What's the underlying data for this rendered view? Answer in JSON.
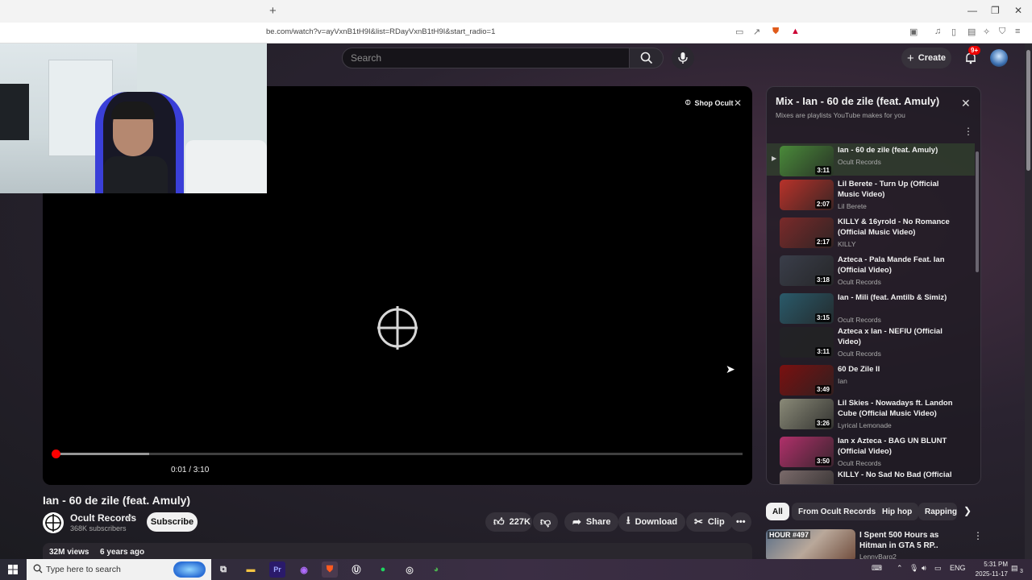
{
  "browser": {
    "new_tab": "+",
    "url": "be.com/watch?v=ayVxnB1tH9I&list=RDayVxnB1tH9I&start_radio=1",
    "window_controls": [
      "—",
      "❐",
      "✕"
    ]
  },
  "masthead": {
    "search_placeholder": "Search",
    "create_label": "Create",
    "notifications_badge": "9+"
  },
  "player": {
    "shop_label": "Shop Ocult",
    "time": "0:01 / 3:10",
    "progress_fraction": 0.005,
    "buffer_fraction": 0.14
  },
  "video": {
    "title": "Ian - 60 de zile (feat. Amuly)",
    "channel": "Ocult Records",
    "subscribers": "368K subscribers",
    "subscribe_label": "Subscribe",
    "likes": "227K",
    "share_label": "Share",
    "download_label": "Download",
    "clip_label": "Clip",
    "views": "32M views",
    "age": "6 years ago"
  },
  "playlist": {
    "title": "Mix - Ian - 60 de zile (feat. Amuly)",
    "subtitle": "Mixes are playlists YouTube makes for you",
    "items": [
      {
        "title": "Ian - 60 de zile (feat. Amuly)",
        "channel": "Ocult Records",
        "duration": "3:11",
        "color": "#4a8a3a"
      },
      {
        "title": "Lil Berete - Turn Up (Official Music Video)",
        "channel": "Lil Berete",
        "duration": "2:07",
        "color": "#b8322a"
      },
      {
        "title": "KILLY & 16yrold - No Romance (Official Music Video)",
        "channel": "KILLY",
        "duration": "2:17",
        "color": "#7a2a2a"
      },
      {
        "title": "Azteca - Pala Mande Feat. Ian (Official Video)",
        "channel": "Ocult Records",
        "duration": "3:18",
        "color": "#3a3e4a"
      },
      {
        "title": "Ian - Mili (feat. Amtilb & Simiz)",
        "channel": "Ocult Records",
        "duration": "3:15",
        "color": "#2a5a6a"
      },
      {
        "title": "Azteca x Ian - NEFIU (Official Video)",
        "channel": "Ocult Records",
        "duration": "3:11",
        "color": "#222226"
      },
      {
        "title": "60 De Zile II",
        "channel": "Ian",
        "duration": "3:49",
        "color": "#7a1010"
      },
      {
        "title": "Lil Skies - Nowadays ft. Landon Cube (Official Music Video)",
        "channel": "Lyrical Lemonade",
        "duration": "3:26",
        "color": "#8a8a78"
      },
      {
        "title": "Ian x Azteca - BAG UN BLUNT (Official Video)",
        "channel": "Ocult Records",
        "duration": "3:50",
        "color": "#b0306a"
      },
      {
        "title": "KILLY - No Sad No Bad (Official",
        "channel": "",
        "duration": "",
        "color": "#7a6a6a"
      }
    ]
  },
  "chips": [
    "All",
    "From Ocult Records",
    "Hip hop",
    "Rapping"
  ],
  "recommended": {
    "title": "I Spent 500 Hours as Hitman in GTA 5 RP..",
    "channel": "LennyBarg2",
    "thumb_label": "HOUR #497"
  },
  "taskbar": {
    "search_placeholder": "Type here to search",
    "lang": "ENG",
    "time": "5:31 PM",
    "date": "2025-11-17",
    "notif_count": "3"
  },
  "colors": {
    "accent_red": "#ff0000",
    "active_row": "#3c5a32"
  }
}
